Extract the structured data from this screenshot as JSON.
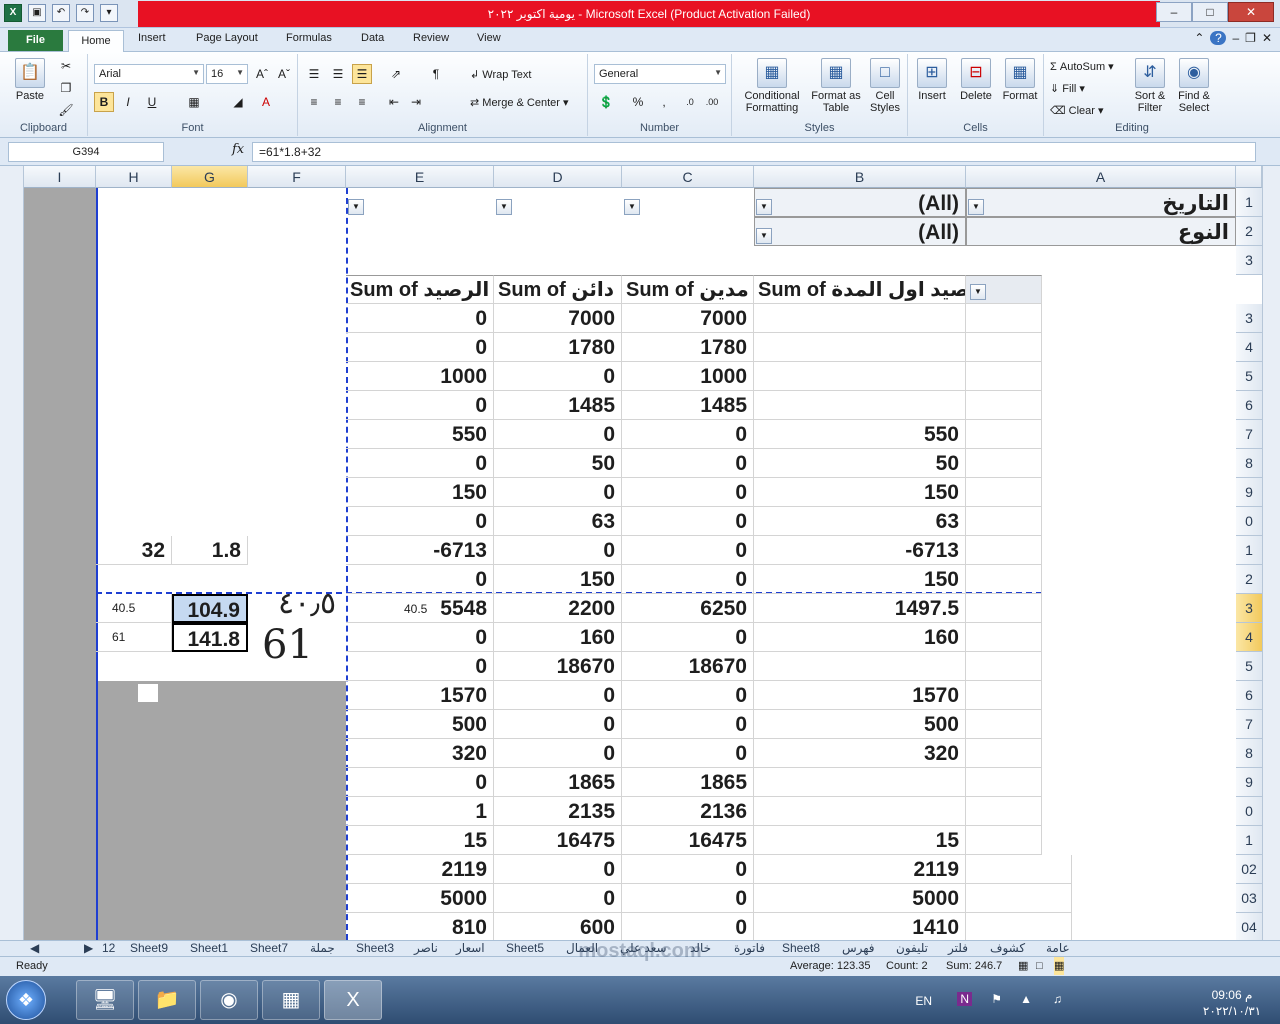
{
  "window": {
    "title": "يومية اكتوبر ٢٠٢٢  -  Microsoft Excel (Product Activation Failed)"
  },
  "ribbon": {
    "tabs": [
      "File",
      "Home",
      "Insert",
      "Page Layout",
      "Formulas",
      "Data",
      "Review",
      "View"
    ],
    "clipboard": {
      "paste": "Paste",
      "label": "Clipboard"
    },
    "font": {
      "name": "Arial",
      "size": "16",
      "bold": "B",
      "italic": "I",
      "underline": "U",
      "label": "Font"
    },
    "alignment": {
      "wrap": "Wrap Text",
      "merge": "Merge & Center",
      "label": "Alignment"
    },
    "number": {
      "format": "General",
      "percent": "%",
      "comma": ",",
      "label": "Number"
    },
    "styles": {
      "conditional": "Conditional Formatting",
      "format_table": "Format as Table",
      "cell_styles": "Cell Styles",
      "label": "Styles"
    },
    "cells": {
      "insert": "Insert",
      "delete": "Delete",
      "format": "Format",
      "label": "Cells"
    },
    "editing": {
      "autosum": "AutoSum",
      "fill": "Fill",
      "clear": "Clear",
      "sort": "Sort & Filter",
      "find": "Find & Select",
      "label": "Editing"
    }
  },
  "formula_bar": {
    "name_box": "G394",
    "fx": "fx",
    "formula": "=61*1.8+32"
  },
  "columns": [
    "I",
    "H",
    "G",
    "F",
    "E",
    "D",
    "C",
    "B",
    "A"
  ],
  "row_headers": [
    "1",
    "2",
    "3",
    "3",
    "4",
    "5",
    "6",
    "7",
    "8",
    "9",
    "0",
    "1",
    "2",
    "3",
    "4",
    "5",
    "6",
    "7",
    "8",
    "9",
    "0",
    "1",
    "02",
    "03",
    "04"
  ],
  "filters": {
    "date_label": "التاريخ",
    "date_value": "(All)",
    "type_label": "النوع",
    "type_value": "(All)"
  },
  "pivot": {
    "headers": [
      "Sum of الرصيد",
      "Sum of دائن",
      "Sum of مدين",
      "Sum of رصيد اول المدة"
    ],
    "rows": [
      [
        "0",
        "7000",
        "7000",
        ""
      ],
      [
        "0",
        "1780",
        "1780",
        ""
      ],
      [
        "1000",
        "0",
        "1000",
        ""
      ],
      [
        "0",
        "1485",
        "1485",
        ""
      ],
      [
        "550",
        "0",
        "0",
        "550"
      ],
      [
        "0",
        "50",
        "0",
        "50"
      ],
      [
        "150",
        "0",
        "0",
        "150"
      ],
      [
        "0",
        "63",
        "0",
        "63"
      ],
      [
        "-6713",
        "0",
        "0",
        "-6713"
      ],
      [
        "0",
        "150",
        "0",
        "150"
      ],
      [
        "5548",
        "2200",
        "6250",
        "1497.5"
      ],
      [
        "0",
        "160",
        "0",
        "160"
      ],
      [
        "0",
        "18670",
        "18670",
        ""
      ],
      [
        "1570",
        "0",
        "0",
        "1570"
      ],
      [
        "500",
        "0",
        "0",
        "500"
      ],
      [
        "320",
        "0",
        "0",
        "320"
      ],
      [
        "0",
        "1865",
        "1865",
        ""
      ],
      [
        "1",
        "2135",
        "2136",
        ""
      ],
      [
        "15",
        "16475",
        "16475",
        "15"
      ],
      [
        "2119",
        "0",
        "0",
        "2119"
      ],
      [
        "5000",
        "0",
        "0",
        "5000"
      ],
      [
        "810",
        "600",
        "0",
        "1410"
      ]
    ],
    "e_note": "40.5"
  },
  "side_values": {
    "h11": "32",
    "g11": "1.8",
    "h13": "40.5",
    "g13": "104.9",
    "h14": "61",
    "g14": "141.8",
    "hand1": "٤٠٫٥",
    "hand2": "61"
  },
  "sheet_tabs": [
    "12",
    "Sheet9",
    "Sheet1",
    "Sheet7",
    "جملة",
    "Sheet3",
    "ناصر",
    "اسعار",
    "Sheet5",
    "العمال",
    "سعد علي",
    "خالد",
    "فاتورة",
    "Sheet8",
    "فهرس",
    "تليفون",
    "فلتر",
    "كشوف",
    "عامة"
  ],
  "status": {
    "ready": "Ready",
    "average": "Average: 123.35",
    "count": "Count: 2",
    "sum": "Sum: 246.7"
  },
  "taskbar": {
    "lang": "EN",
    "time": "09:06 م",
    "date": "٢٠٢٢/١٠/٣١"
  },
  "watermark": "mostaql.com"
}
